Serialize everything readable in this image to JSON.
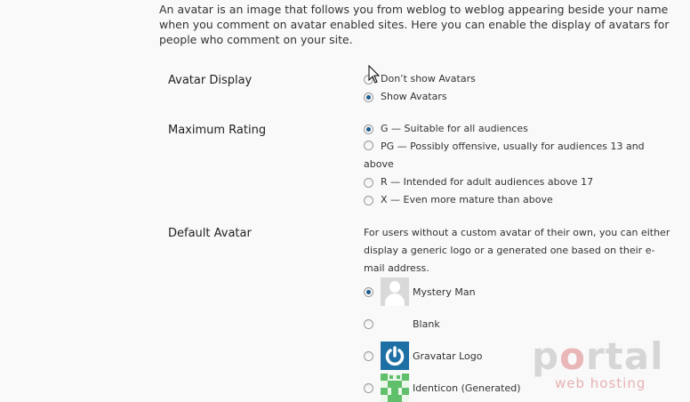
{
  "intro": "An avatar is an image that follows you from weblog to weblog appearing beside your name when you comment on avatar enabled sites. Here you can enable the display of avatars for people who comment on your site.",
  "avatar_display": {
    "label": "Avatar Display",
    "options": [
      {
        "label": "Don’t show Avatars",
        "checked": false
      },
      {
        "label": "Show Avatars",
        "checked": true
      }
    ]
  },
  "max_rating": {
    "label": "Maximum Rating",
    "options": [
      {
        "label": "G — Suitable for all audiences",
        "checked": true
      },
      {
        "label": "PG — Possibly offensive, usually for audiences 13 and above",
        "checked": false
      },
      {
        "label": "R — Intended for adult audiences above 17",
        "checked": false
      },
      {
        "label": "X — Even more mature than above",
        "checked": false
      }
    ]
  },
  "default_avatar": {
    "label": "Default Avatar",
    "description": "For users without a custom avatar of their own, you can either display a generic logo or a generated one based on their e-mail address.",
    "options": [
      {
        "label": "Mystery Man",
        "checked": true,
        "icon": "mystery-man-icon"
      },
      {
        "label": "Blank",
        "checked": false,
        "icon": "blank-icon"
      },
      {
        "label": "Gravatar Logo",
        "checked": false,
        "icon": "gravatar-logo-icon"
      },
      {
        "label": "Identicon (Generated)",
        "checked": false,
        "icon": "identicon-icon"
      }
    ]
  },
  "watermark": {
    "main_p1": "p",
    "main_o": "o",
    "main_p2": "rtal",
    "sub": "web hosting"
  },
  "colors": {
    "radio_dot": "#1d5d8c",
    "gravatar_bg": "#1e6fa3",
    "identicon": "#5fbf6a",
    "watermark_accent": "#e8b1b1"
  }
}
